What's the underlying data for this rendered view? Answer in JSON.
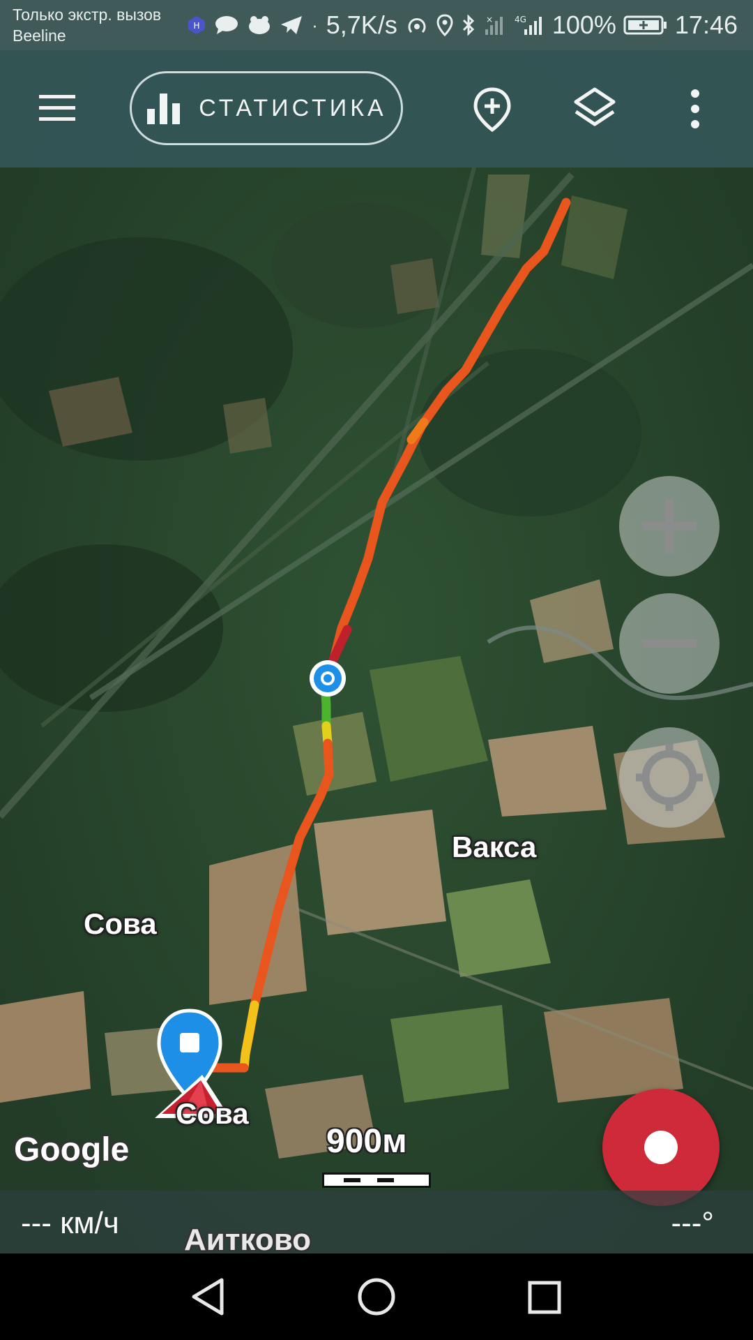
{
  "status_bar": {
    "carrier_line1": "Только экстр. вызов",
    "carrier_line2": "Beeline",
    "speed": "5,7K/s",
    "network": "4G",
    "battery": "100%",
    "time": "17:46"
  },
  "toolbar": {
    "stats_label": "СТАТИСТИКА"
  },
  "map": {
    "places": {
      "vaksa": "Вакса",
      "sova_upper": "Сова",
      "sova_lower": "Сова",
      "aitkovo": "Аитково"
    },
    "attribution": "Google",
    "scale_label": "900м"
  },
  "controls": {
    "zoom_in": "+",
    "zoom_out": "−"
  },
  "info_bar": {
    "speed": "--- км/ч",
    "heading": "---°"
  },
  "colors": {
    "record": "#cf2a3a",
    "track_main": "#e8561d",
    "track_fast": "#c0202b",
    "track_slow": "#f2c21a",
    "marker": "#1e8fe6"
  }
}
